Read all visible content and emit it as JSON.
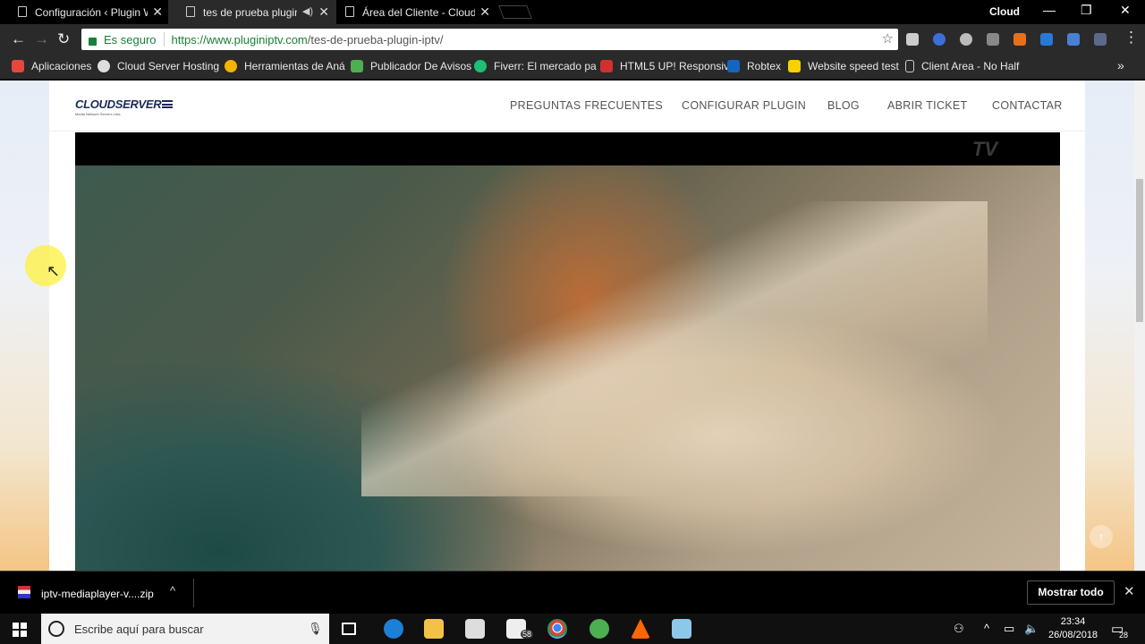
{
  "browser": {
    "tabs": [
      {
        "title": "Configuración ‹ Plugin W",
        "active": false
      },
      {
        "title": "tes de prueba plugin",
        "active": true
      },
      {
        "title": "Área del Cliente - Cloud S",
        "active": false
      }
    ],
    "profile": "Cloud",
    "secure_label": "Es seguro",
    "url_host": "https://www.pluginiptv.com",
    "url_path": "/tes-de-prueba-plugin-iptv/",
    "bookmarks": [
      {
        "label": "Aplicaciones",
        "color": "#e8453c"
      },
      {
        "label": "Cloud Server Hosting",
        "color": "#dddddd"
      },
      {
        "label": "Herramientas de Aná",
        "color": "#f4b400"
      },
      {
        "label": "Publicador De Avisos",
        "color": "#4caf50"
      },
      {
        "label": "Fiverr: El mercado pa",
        "color": "#1dbf73"
      },
      {
        "label": "HTML5 UP! Responsiv",
        "color": "#d32f2f"
      },
      {
        "label": "Robtex",
        "color": "#1565c0"
      },
      {
        "label": "Website speed test",
        "color": "#f9d000"
      },
      {
        "label": "Client Area - No Half",
        "color": "#eeeeee"
      }
    ],
    "bookmarks_overflow": "»"
  },
  "site": {
    "logo": "CLOUDSERVER",
    "logo_sub": "Media Network Servers Ltda",
    "menu": [
      "PREGUNTAS FRECUENTES",
      "CONFIGURAR PLUGIN",
      "BLOG",
      "ABRIR TICKET",
      "CONTACTAR"
    ],
    "watermark": "TV"
  },
  "downloads": {
    "file": "iptv-mediaplayer-v....zip",
    "show_all": "Mostrar todo"
  },
  "taskbar": {
    "search_placeholder": "Escribe aquí para buscar",
    "mail_badge": "58",
    "time": "23:34",
    "date": "26/08/2018",
    "notifications": "28"
  }
}
